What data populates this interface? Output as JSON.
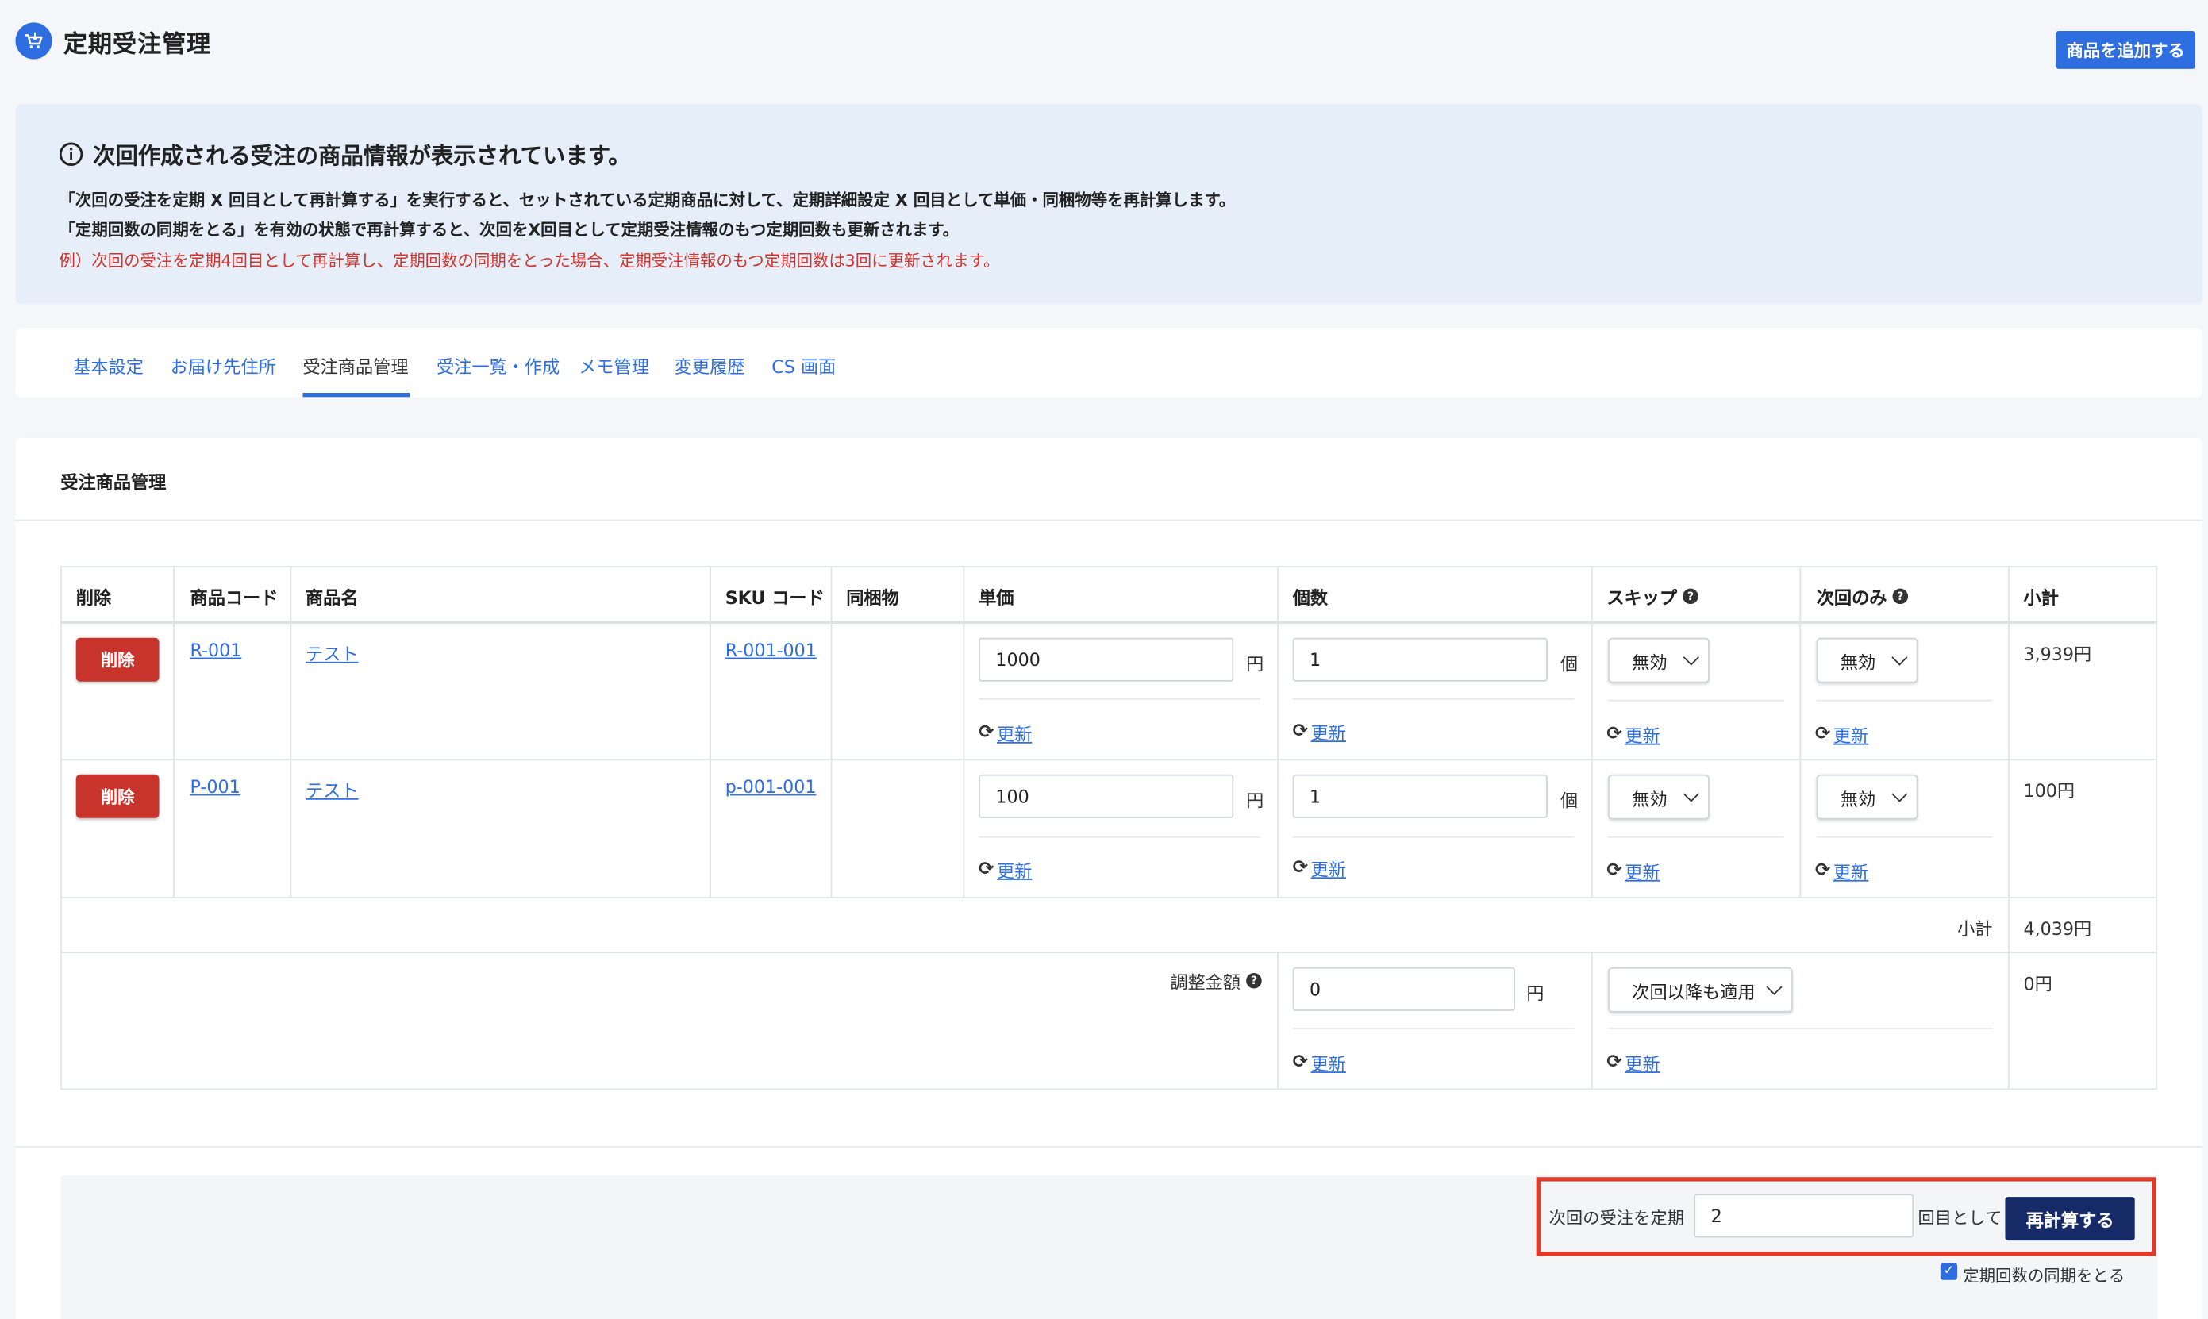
{
  "header": {
    "title": "定期受注管理",
    "add_product_label": "商品を追加する"
  },
  "info": {
    "title": "次回作成される受注の商品情報が表示されています。",
    "line1": "「次回の受注を定期 X 回目として再計算する」を実行すると、セットされている定期商品に対して、定期詳細設定 X 回目として単価・同梱物等を再計算します。",
    "line2": "「定期回数の同期をとる」を有効の状態で再計算すると、次回をX回目として定期受注情報のもつ定期回数も更新されます。",
    "line3": "例）次回の受注を定期4回目として再計算し、定期回数の同期をとった場合、定期受注情報のもつ定期回数は3回に更新されます。"
  },
  "tabs": [
    {
      "label": "基本設定"
    },
    {
      "label": "お届け先住所"
    },
    {
      "label": "受注商品管理"
    },
    {
      "label": "受注一覧・作成"
    },
    {
      "label": "メモ管理"
    },
    {
      "label": "変更履歴"
    },
    {
      "label": "CS 画面"
    }
  ],
  "section": {
    "title": "受注商品管理"
  },
  "table": {
    "headers": {
      "delete": "削除",
      "product_code": "商品コード",
      "product_name": "商品名",
      "sku_code": "SKU コード",
      "bundled": "同梱物",
      "unit_price": "単価",
      "quantity": "個数",
      "skip": "スキップ",
      "next_only": "次回のみ",
      "subtotal": "小計"
    },
    "delete_label": "削除",
    "yen_unit": "円",
    "qty_unit": "個",
    "update_label": "更新",
    "rows": [
      {
        "product_code": "R-001",
        "product_name": "テスト",
        "sku_code": "R-001-001",
        "unit_price": "1000",
        "quantity": "1",
        "skip": "無効",
        "next_only": "無効",
        "subtotal": "3,939円"
      },
      {
        "product_code": "P-001",
        "product_name": "テスト",
        "sku_code": "p-001-001",
        "unit_price": "100",
        "quantity": "1",
        "skip": "無効",
        "next_only": "無効",
        "subtotal": "100円"
      }
    ],
    "subtotal_label": "小計",
    "subtotal_value": "4,039円",
    "adjustment": {
      "label": "調整金額",
      "value": "0",
      "unit": "円",
      "apply": "次回以降も適用",
      "amount": "0円"
    }
  },
  "recalc": {
    "prefix": "次回の受注を定期",
    "value": "2",
    "suffix": "回目として",
    "button": "再計算する",
    "sync_label": "定期回数の同期をとる"
  },
  "colors": {
    "primary": "#2f6ee0",
    "danger": "#c8342b",
    "navy": "#152a66",
    "highlight": "#e23a26",
    "info_bg": "#e5eef9"
  }
}
